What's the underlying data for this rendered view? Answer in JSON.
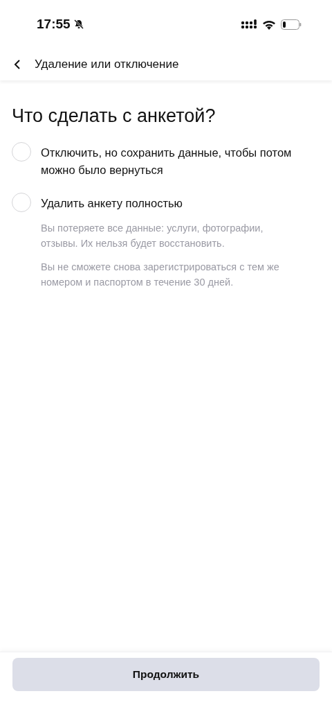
{
  "status_bar": {
    "time": "17:55"
  },
  "header": {
    "title": "Удаление или отключение"
  },
  "question": "Что сделать с анкетой?",
  "options": [
    {
      "label": "Отключить, но сохранить данные, чтобы потом можно было вернуться",
      "selected": false
    },
    {
      "label": "Удалить анкету полностью",
      "selected": false,
      "notes": [
        "Вы потеряете все данные: услуги, фотографии, отзывы. Их нельзя будет восстановить.",
        "Вы не сможете снова зарегистрироваться с тем же номером и паспортом в течение 30 дней."
      ]
    }
  ],
  "continue_button": {
    "label": "Продолжить"
  }
}
